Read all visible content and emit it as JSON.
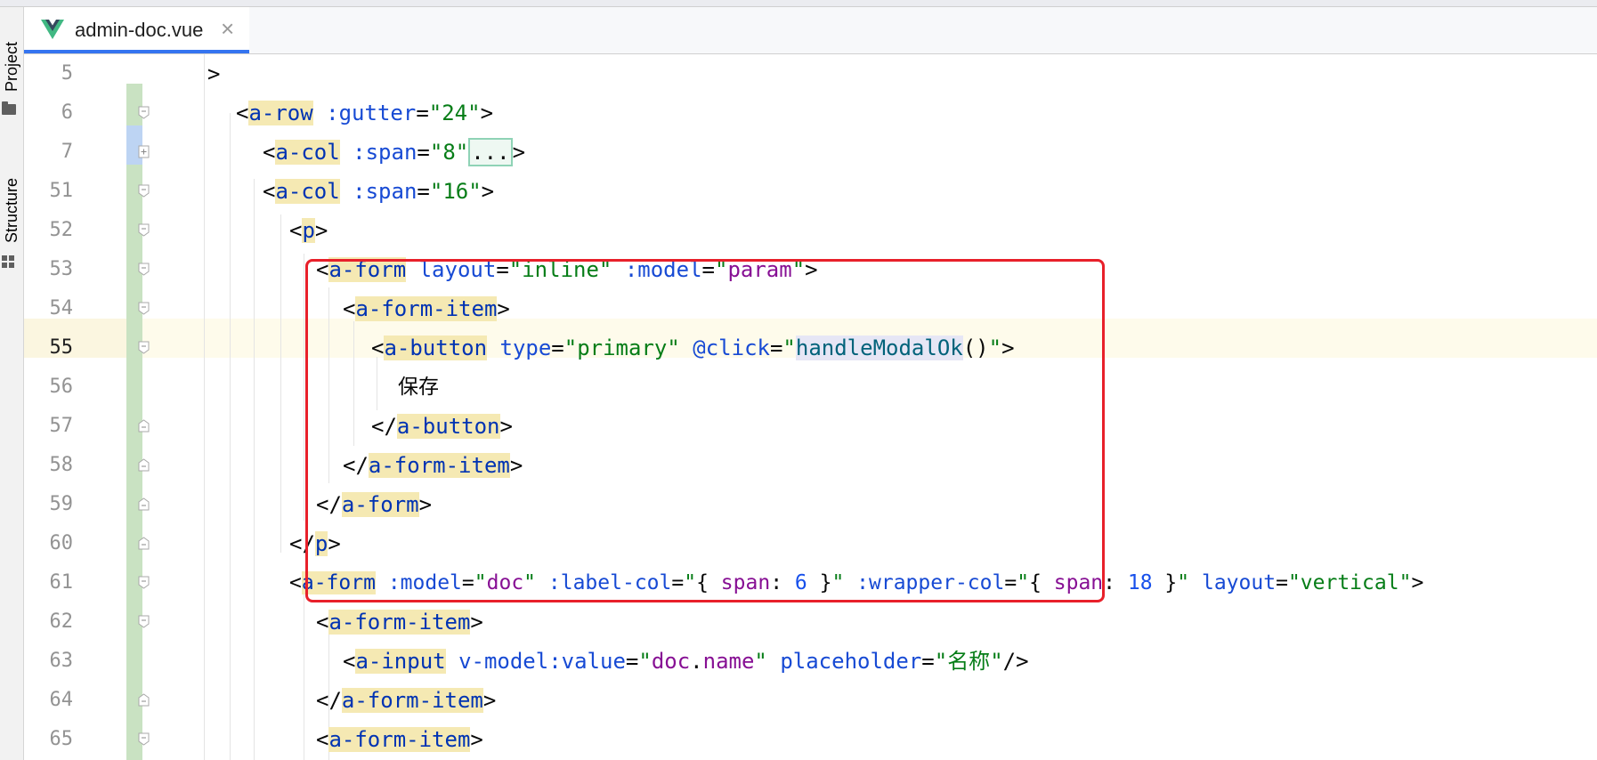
{
  "tool_windows": {
    "project": "Project",
    "structure": "Structure"
  },
  "tab": {
    "filename": "admin-doc.vue",
    "close": "×"
  },
  "colors": {
    "tag": "#0033b3",
    "attribute": "#174ad4",
    "string": "#067d17",
    "highlight": "#f5e9b3",
    "callout": "#e8202a"
  },
  "lines": [
    {
      "num": "5",
      "text": ">"
    },
    {
      "num": "6",
      "text": "<a-row :gutter=\"24\">"
    },
    {
      "num": "7",
      "text": "<a-col :span=\"8\"...>"
    },
    {
      "num": "51",
      "text": "<a-col :span=\"16\">"
    },
    {
      "num": "52",
      "text": "<p>"
    },
    {
      "num": "53",
      "text": "<a-form layout=\"inline\" :model=\"param\">"
    },
    {
      "num": "54",
      "text": "<a-form-item>"
    },
    {
      "num": "55",
      "text": "<a-button type=\"primary\" @click=\"handleModalOk()\">"
    },
    {
      "num": "56",
      "text": "保存"
    },
    {
      "num": "57",
      "text": "</a-button>"
    },
    {
      "num": "58",
      "text": "</a-form-item>"
    },
    {
      "num": "59",
      "text": "</a-form>"
    },
    {
      "num": "60",
      "text": "</p>"
    },
    {
      "num": "61",
      "text": "<a-form :model=\"doc\" :label-col=\"{ span: 6 }\" :wrapper-col=\"{ span: 18 }\" layout=\"vertical\">"
    },
    {
      "num": "62",
      "text": "<a-form-item>"
    },
    {
      "num": "63",
      "text": "<a-input v-model:value=\"doc.name\" placeholder=\"名称\"/>"
    },
    {
      "num": "64",
      "text": "</a-form-item>"
    },
    {
      "num": "65",
      "text": "<a-form-item>"
    }
  ]
}
